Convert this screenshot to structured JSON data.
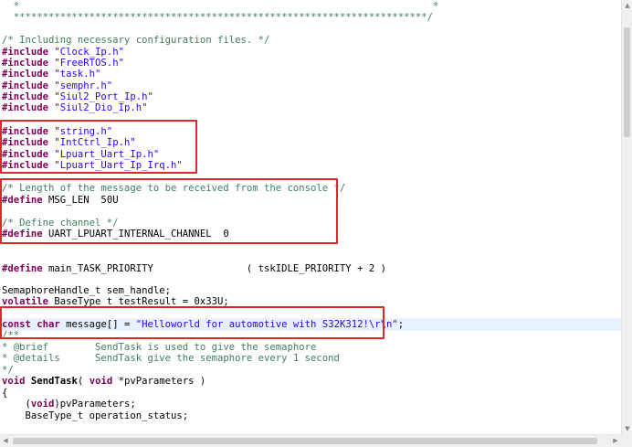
{
  "editor": {
    "lines": {
      "l01": "  *                                                                       *",
      "l02": "  ***********************************************************************/",
      "l03": "/* Including necessary configuration files. */",
      "inc_kw": "#include",
      "def_kw": "#define",
      "f1": " \"Clock_Ip.h\"",
      "f2": " \"FreeRTOS.h\"",
      "f3": " \"task.h\"",
      "f4": " \"semphr.h\"",
      "f5": " \"Siul2_Port_Ip.h\"",
      "f6": " \"Siul2_Dio_Ip.h\"",
      "f7": " \"string.h\"",
      "f8": " \"IntCtrl_Ip.h\"",
      "f9": " \"Lpuart_Uart_Ip.h\"",
      "f10": " \"Lpuart_Uart_Ip_Irq.h\"",
      "c_len": "/* Length of the message to be received from the console */",
      "msg_len": " MSG_LEN  50U",
      "c_chan": "/* Define channel */",
      "uart_chan": " UART_LPUART_INTERNAL_CHANNEL  0",
      "task_prio": " main_TASK_PRIORITY                ( tskIDLE_PRIORITY + 2 )",
      "sem": "SemaphoreHandle_t sem_handle;",
      "volatile_kw": "volatile",
      "vol_rest": " BaseType_t testResult = 0x33U;",
      "const_kw": "const",
      "char_kw": "char",
      "msg_decl": " message[] = ",
      "msg_str": "\"Helloworld for automotive with S32K312!\\r\\n\"",
      "semi": ";",
      "doc_open": "/**",
      "brief": "* @brief        SendTask is used to give the semaphore",
      "details": "* @details      SendTask give the semaphore every 1 second",
      "doc_close": "*/",
      "void_kw": "void",
      "sendtask": "SendTask",
      "sig_open": "( ",
      "sig_rest": " *pvParameters )",
      "brace": "{",
      "cast_open": "    (",
      "cast_rest": ")pvParameters;",
      "status": "    BaseType_t operation_status;"
    }
  },
  "scrollbar": {
    "up_arrow": "▲",
    "down_arrow": "▼",
    "left_arrow": "◀",
    "right_arrow": "▶"
  }
}
